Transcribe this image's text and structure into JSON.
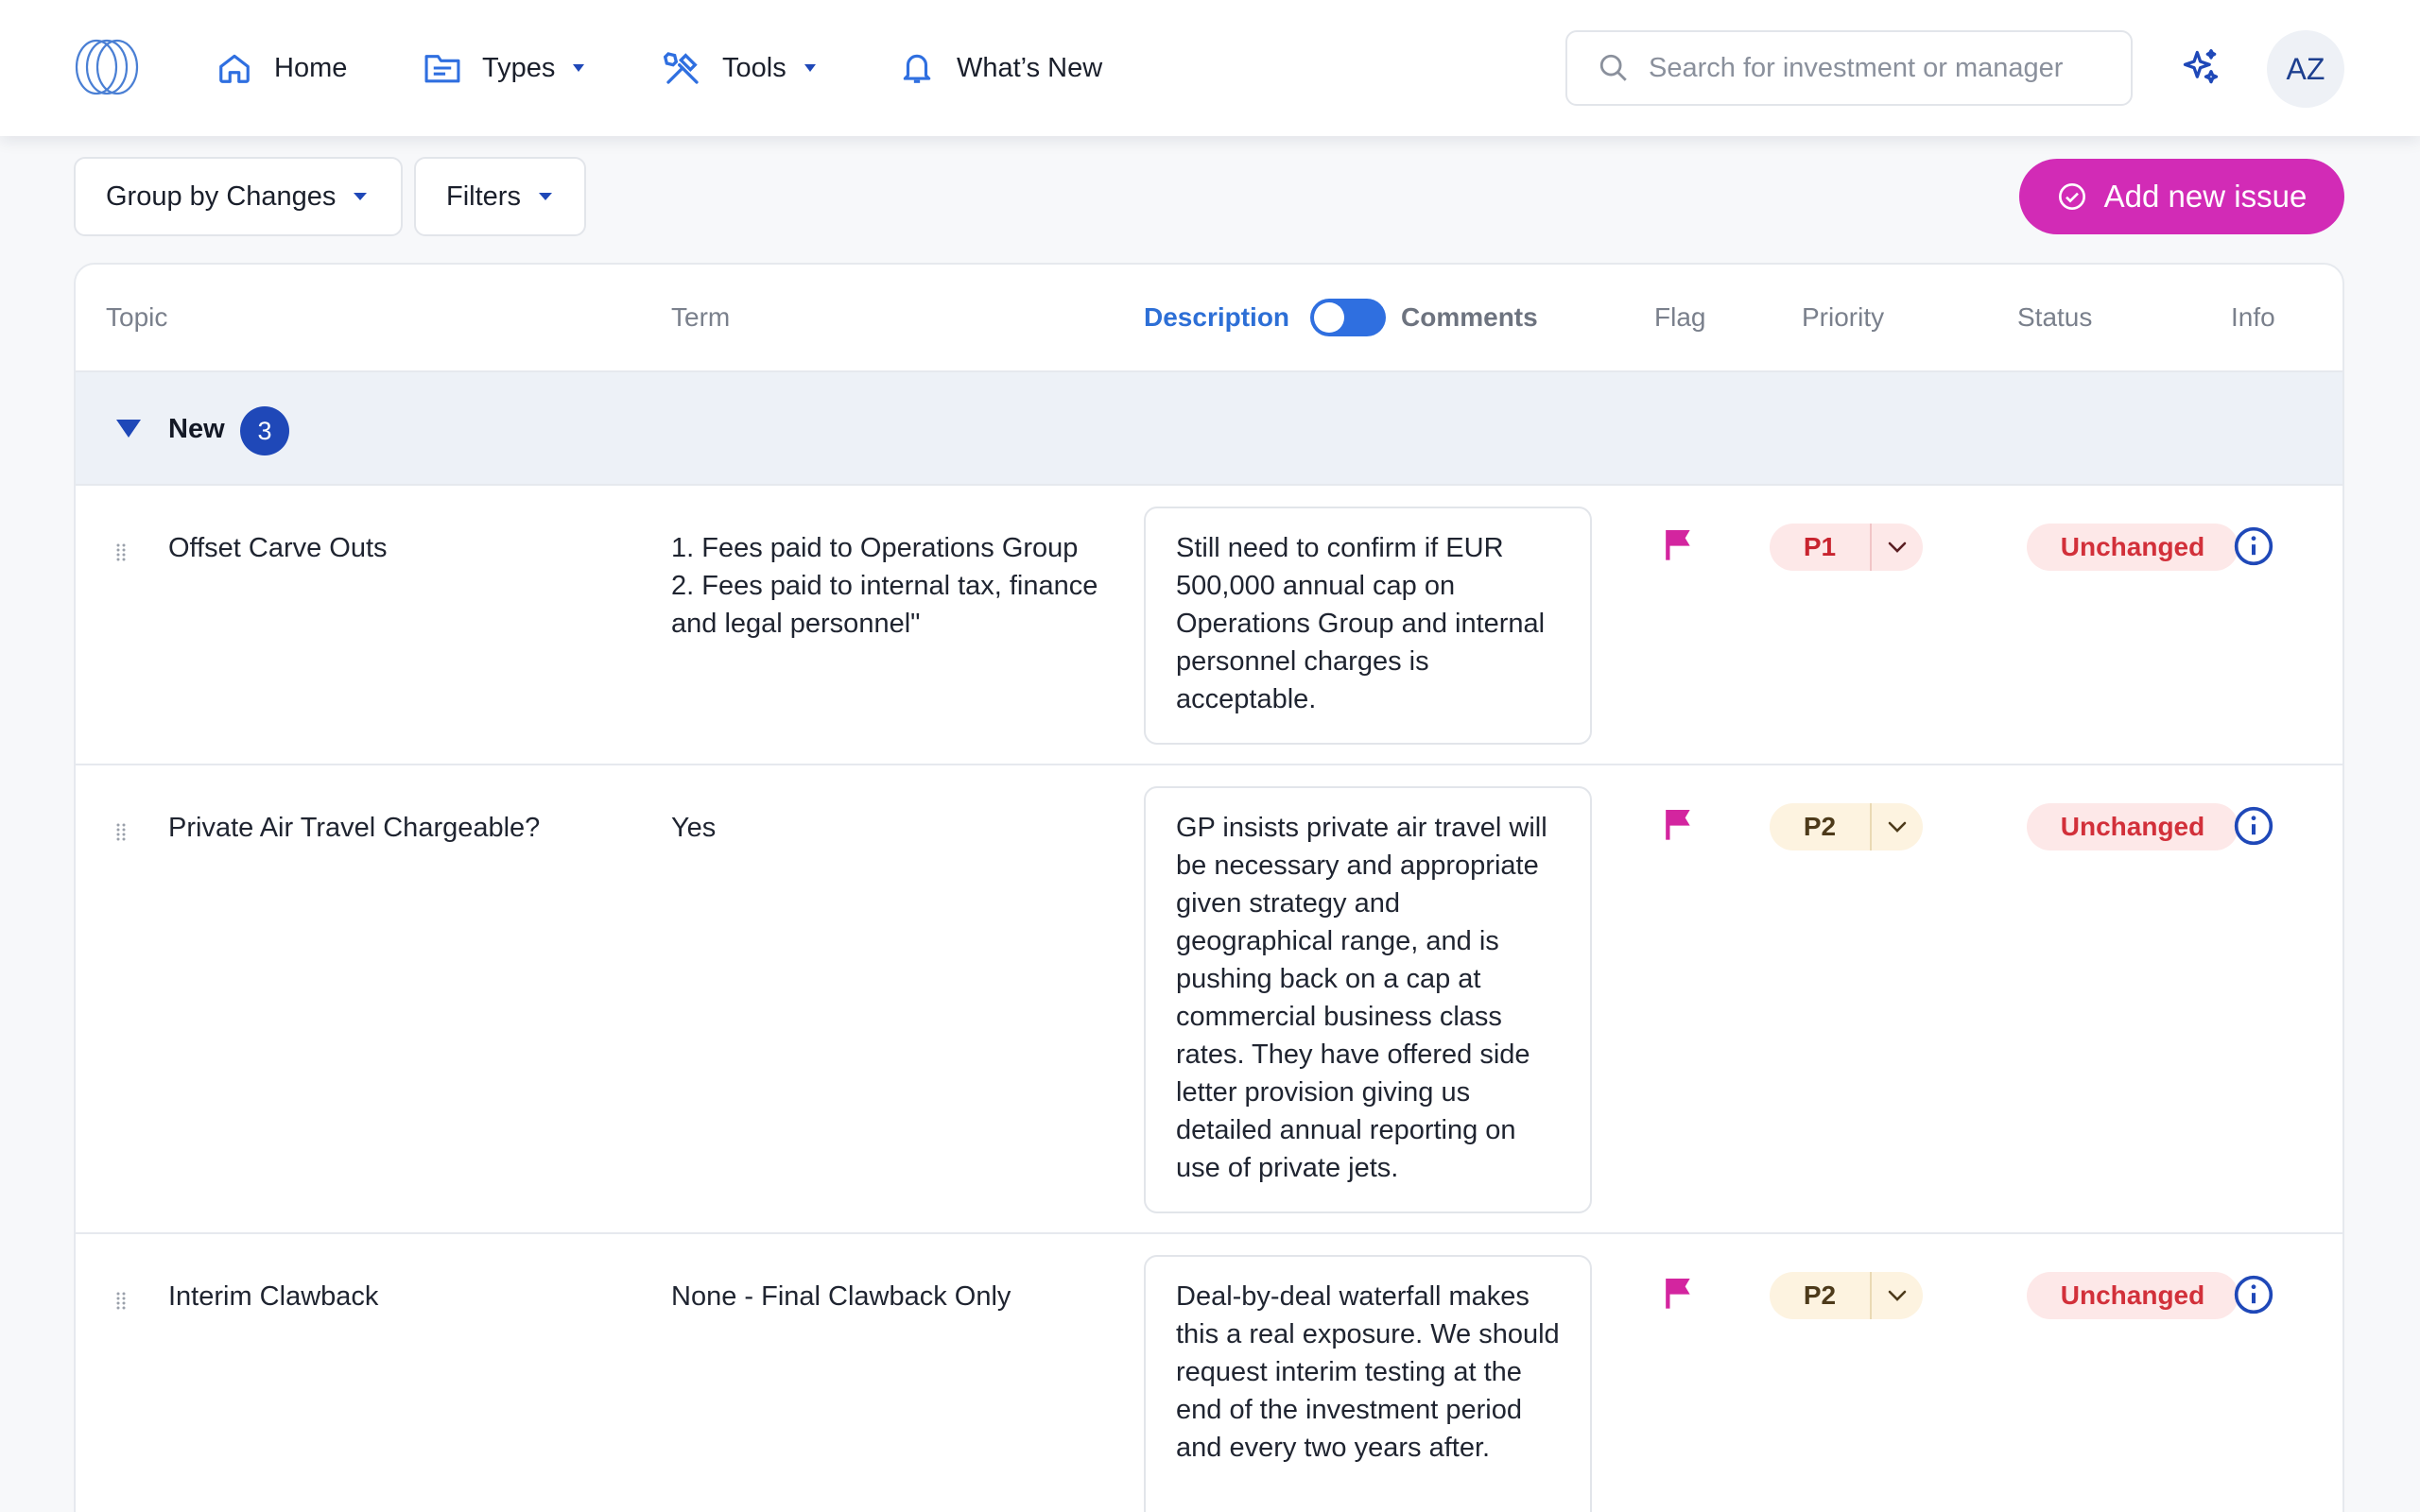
{
  "nav": {
    "items": [
      {
        "label": "Home",
        "icon": "home-icon"
      },
      {
        "label": "Types",
        "icon": "folder-icon",
        "has_caret": true
      },
      {
        "label": "Tools",
        "icon": "tools-icon",
        "has_caret": true
      },
      {
        "label": "What’s New",
        "icon": "bell-icon"
      }
    ],
    "search_placeholder": "Search for investment or manager",
    "user_initials": "AZ"
  },
  "toolbar": {
    "group_by_label": "Group by Changes",
    "filters_label": "Filters",
    "add_button_label": "Add new issue"
  },
  "table": {
    "columns": {
      "topic": "Topic",
      "term": "Term",
      "description": "Description",
      "comments": "Comments",
      "flag": "Flag",
      "priority": "Priority",
      "status": "Status",
      "info": "Info"
    },
    "toggle_selected": "Description",
    "group": {
      "label": "New",
      "count": "3"
    },
    "rows": [
      {
        "topic": "Offset Carve Outs",
        "term_lines": [
          "1. Fees paid to Operations Group",
          "2. Fees paid to internal tax, finance and legal personnel\""
        ],
        "description": "Still need to confirm if EUR 500,000 annual cap on Operations Group and internal personnel charges is acceptable.",
        "flagged": true,
        "priority": "P1",
        "status": "Unchanged"
      },
      {
        "topic": "Private Air Travel Chargeable?",
        "term_lines": [
          "Yes"
        ],
        "description": "GP insists private air travel will be necessary and appropriate given strategy and geographical range, and is pushing back on a cap at commercial business class rates. They have offered side letter provision giving us detailed annual reporting on use of private jets.",
        "flagged": true,
        "priority": "P2",
        "status": "Unchanged"
      },
      {
        "topic": "Interim Clawback",
        "term_lines": [
          "None - Final Clawback Only"
        ],
        "description": "Deal-by-deal waterfall makes this a real exposure. We should request interim testing at the end of the investment period and every two years after.",
        "flagged": true,
        "priority": "P2",
        "status": "Unchanged"
      }
    ]
  },
  "colors": {
    "accent_blue": "#2d6fd6",
    "brand_magenta": "#d22bb6",
    "flag_magenta": "#d3259f",
    "status_red": "#d2303a",
    "group_badge": "#1f48b8"
  }
}
